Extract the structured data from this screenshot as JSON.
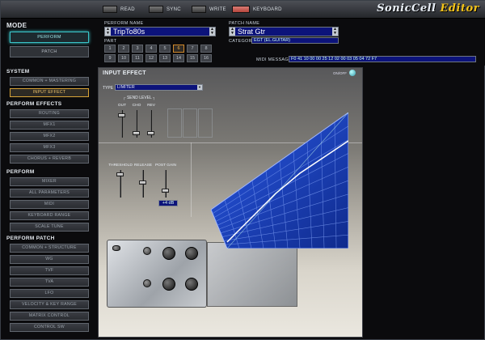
{
  "toolbar": {
    "read_label": "READ",
    "sync_label": "SYNC",
    "write_label": "WRITE",
    "keyboard_label": "KEYBOARD",
    "logo_main": "SonicCell",
    "logo_accent": " Editor"
  },
  "mode": {
    "title": "MODE",
    "perform_label": "PERFORM",
    "patch_label": "PATCH",
    "active": "PERFORM"
  },
  "sidebar": {
    "system": {
      "title": "SYSTEM",
      "items": [
        "COMMON + MASTERING",
        "INPUT EFFECT"
      ],
      "selected": "INPUT EFFECT"
    },
    "perform_effects": {
      "title": "PERFORM EFFECTS",
      "items": [
        "ROUTING",
        "MFX1",
        "MFX2",
        "MFX3",
        "CHORUS + REVERB"
      ]
    },
    "perform": {
      "title": "PERFORM",
      "items": [
        "MIXER",
        "ALL PARAMETERS",
        "MIDI",
        "KEYBOARD RANGE",
        "SCALE TUNE"
      ]
    },
    "perform_patch": {
      "title": "PERFORM PATCH",
      "items": [
        "COMMON + STRUCTURE",
        "WG",
        "TVF",
        "TVA",
        "LFO",
        "VELOCITY & KEY RANGE",
        "MATRIX CONTROL",
        "CONTROL SW"
      ]
    }
  },
  "header": {
    "perform_name_label": "PERFORM NAME",
    "perform_name": "TripTo80s",
    "patch_name_label": "PATCH NAME",
    "patch_name": "Strat Gtr",
    "category_label": "CATEGORY",
    "category_value": "EGT (EL.GUITAR)",
    "part_label": "PART",
    "parts": [
      "1",
      "2",
      "3",
      "4",
      "5",
      "6",
      "7",
      "8",
      "9",
      "10",
      "11",
      "12",
      "13",
      "14",
      "15",
      "16"
    ],
    "selected_part": "6",
    "midi_message_label": "MIDI MESSAGE",
    "midi_message": "F0 41 10 00 00 25 12 02 00 03 05 04 72 F7"
  },
  "panel": {
    "title": "INPUT EFFECT",
    "on_off_label": "ON/OFF",
    "type_label": "TYPE",
    "type_value": "LIMITER",
    "send_level_label": "SEND LEVEL",
    "send_faders": [
      {
        "label": "OUT",
        "level": 0.85
      },
      {
        "label": "CHO",
        "level": 0.1
      },
      {
        "label": "REV",
        "level": 0.1
      }
    ],
    "dyn_faders": [
      {
        "label": "THRESHOLD",
        "level": 0.9
      },
      {
        "label": "RELEASE",
        "level": 0.55
      },
      {
        "label": "POST GAIN",
        "level": 0.2
      }
    ],
    "post_gain_value": "+4 dB"
  },
  "colors": {
    "accent_cyan": "#39c4c8",
    "selected_orange": "#d7a338",
    "field_blue": "#0c137a",
    "graph_blue": "#1e46c8"
  }
}
